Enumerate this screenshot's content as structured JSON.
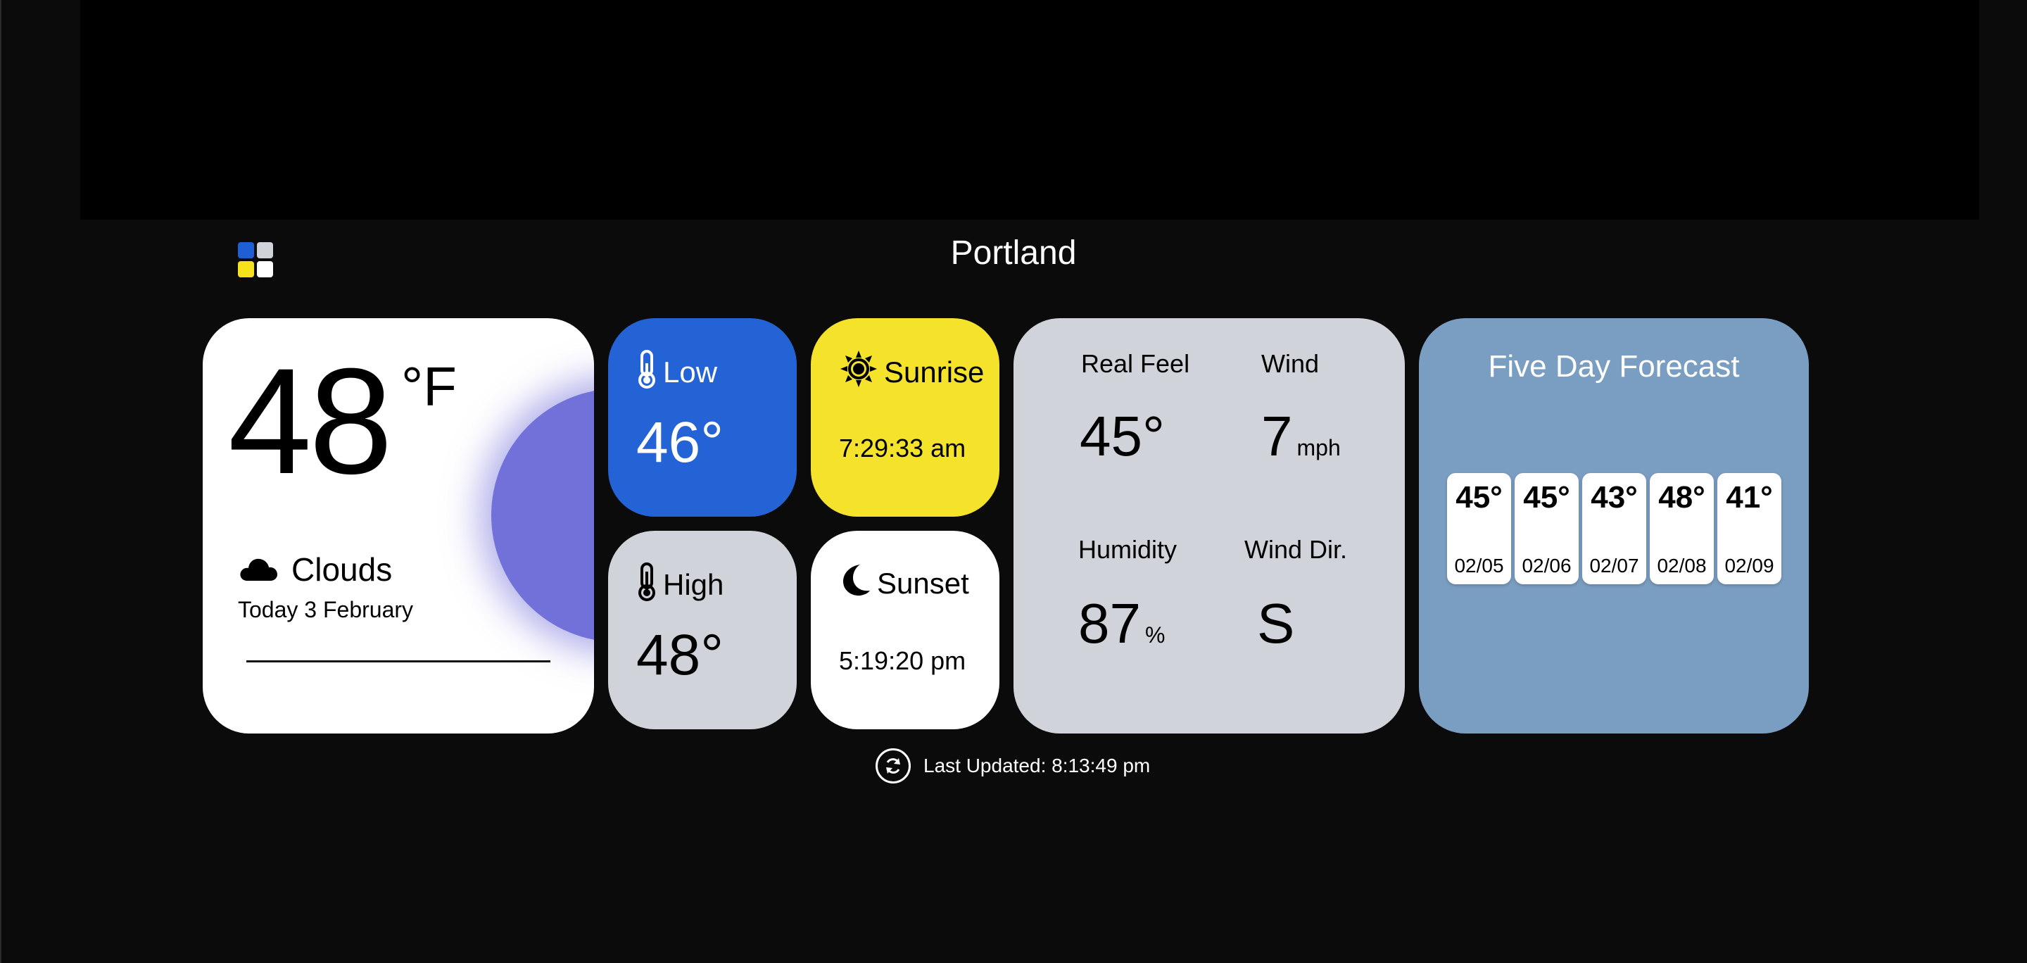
{
  "header": {
    "city": "Portland"
  },
  "current": {
    "temperature": "48",
    "unit": "°F",
    "condition": "Clouds",
    "date": "Today 3 February"
  },
  "low": {
    "label": "Low",
    "value": "46°"
  },
  "high": {
    "label": "High",
    "value": "48°"
  },
  "sunrise": {
    "label": "Sunrise",
    "time": "7:29:33 am"
  },
  "sunset": {
    "label": "Sunset",
    "time": "5:19:20 pm"
  },
  "stats": {
    "real_feel": {
      "label": "Real Feel",
      "value": "45°"
    },
    "wind": {
      "label": "Wind",
      "value": "7",
      "unit": "mph"
    },
    "humidity": {
      "label": "Humidity",
      "value": "87",
      "unit": "%"
    },
    "wind_dir": {
      "label": "Wind Dir.",
      "value": "S"
    }
  },
  "forecast": {
    "title": "Five Day Forecast",
    "days": [
      {
        "temp": "45°",
        "date": "02/05"
      },
      {
        "temp": "45°",
        "date": "02/06"
      },
      {
        "temp": "43°",
        "date": "02/07"
      },
      {
        "temp": "48°",
        "date": "02/08"
      },
      {
        "temp": "41°",
        "date": "02/09"
      }
    ]
  },
  "footer": {
    "last_updated": "Last Updated: 8:13:49 pm"
  },
  "colors": {
    "low_tile": "#2463d6",
    "sunrise_tile": "#f5e22a",
    "forecast_card": "#7a9dc2",
    "stats_card": "#d0d4da",
    "sun_glow": "#7270d9"
  },
  "icons": {
    "logo": "four-squares-logo",
    "condition": "cloud-icon",
    "low": "thermometer-icon",
    "high": "thermometer-icon",
    "sunrise": "sun-icon",
    "sunset": "moon-icon",
    "refresh": "refresh-icon"
  }
}
